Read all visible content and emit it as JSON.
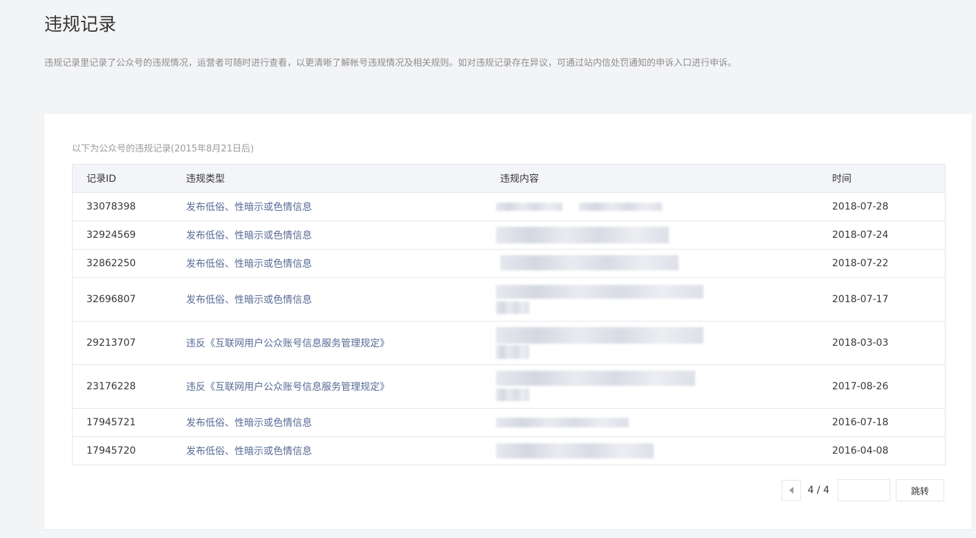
{
  "page": {
    "title": "违规记录",
    "description": "违规记录里记录了公众号的违规情况，运营者可随时进行查看，以更清晰了解帐号违规情况及相关规则。如对违规记录存在异议，可通过站内信处罚通知的申诉入口进行申诉。"
  },
  "records": {
    "subtitle": "以下为公众号的违规记录(2015年8月21日后)",
    "columns": {
      "id": "记录ID",
      "type": "违规类型",
      "content": "违规内容",
      "time": "时间"
    },
    "rows": [
      {
        "id": "33078398",
        "type": "发布低俗、性暗示或色情信息",
        "time": "2018-07-28"
      },
      {
        "id": "32924569",
        "type": "发布低俗、性暗示或色情信息",
        "time": "2018-07-24"
      },
      {
        "id": "32862250",
        "type": "发布低俗、性暗示或色情信息",
        "time": "2018-07-22"
      },
      {
        "id": "32696807",
        "type": "发布低俗、性暗示或色情信息",
        "time": "2018-07-17"
      },
      {
        "id": "29213707",
        "type": "违反《互联网用户公众账号信息服务管理规定》",
        "time": "2018-03-03"
      },
      {
        "id": "23176228",
        "type": "违反《互联网用户公众账号信息服务管理规定》",
        "time": "2017-08-26"
      },
      {
        "id": "17945721",
        "type": "发布低俗、性暗示或色情信息",
        "time": "2016-07-18"
      },
      {
        "id": "17945720",
        "type": "发布低俗、性暗示或色情信息",
        "time": "2016-04-08"
      }
    ]
  },
  "pagination": {
    "page_indicator": "4 / 4",
    "jump_input_value": "",
    "jump_label": "跳转",
    "prev_icon": "triangle-left-icon"
  },
  "colors": {
    "link": "#576b95",
    "background": "#f3f4f6",
    "header_bg": "#f4f5f9"
  }
}
